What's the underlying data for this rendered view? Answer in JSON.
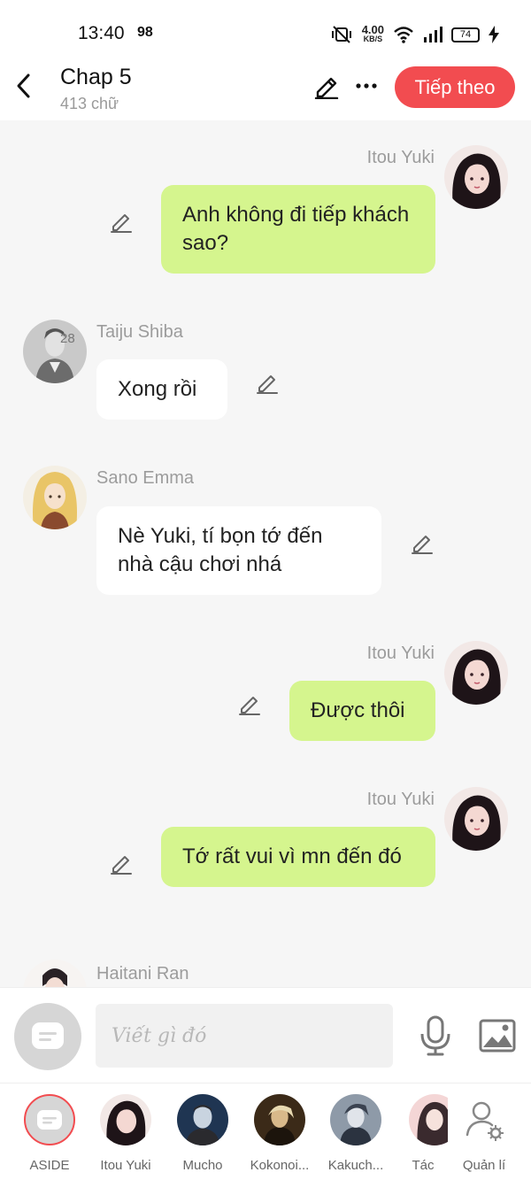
{
  "status_bar": {
    "time": "13:40",
    "badge": "98",
    "speed_value": "4.00",
    "speed_unit": "KB/S",
    "battery": "74"
  },
  "header": {
    "title": "Chap 5",
    "word_count": "413 chữ",
    "next_label": "Tiếp theo"
  },
  "messages": [
    {
      "sender": "Itou Yuki",
      "side": "right",
      "text": "Anh không đi tiếp khách sao?"
    },
    {
      "sender": "Taiju Shiba",
      "side": "left",
      "text": "Xong rồi",
      "avatar_badge": "28"
    },
    {
      "sender": "Sano Emma",
      "side": "left",
      "text": "Nè Yuki, tí bọn tớ đến nhà cậu chơi nhá"
    },
    {
      "sender": "Itou Yuki",
      "side": "right",
      "text": "Được thôi"
    },
    {
      "sender": "Itou Yuki",
      "side": "right",
      "text": "Tớ rất vui vì mn đến đó"
    },
    {
      "sender": "Haitani Ran",
      "side": "left",
      "text": ""
    }
  ],
  "input": {
    "placeholder": "Viết gì đó"
  },
  "characters": [
    {
      "name": "ASIDE"
    },
    {
      "name": "Itou Yuki"
    },
    {
      "name": "Mucho"
    },
    {
      "name": "Kokonoi..."
    },
    {
      "name": "Kakuch..."
    },
    {
      "name": "Tác"
    },
    {
      "name": "Quản lí"
    }
  ],
  "colors": {
    "accent": "#f24c50",
    "my_bubble": "#d5f58e",
    "other_bubble": "#ffffff",
    "background": "#f6f6f6"
  }
}
